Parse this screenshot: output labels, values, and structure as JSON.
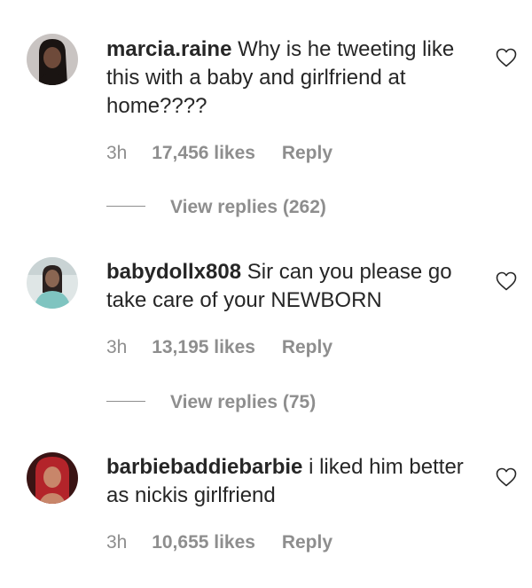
{
  "comments": [
    {
      "username": "marcia.raine",
      "text": "Why is he tweeting like this with a baby and girlfriend at home????",
      "time": "3h",
      "likes": "17,456 likes",
      "reply": "Reply",
      "view_replies": "View replies (262)",
      "avatar_colors": {
        "bg": "#c9c4c2",
        "skin": "#6e4a3a",
        "hair": "#1a1412"
      }
    },
    {
      "username": "babydollx808",
      "text": "Sir can you please go take care of your NEWBORN",
      "time": "3h",
      "likes": "13,195 likes",
      "reply": "Reply",
      "view_replies": "View replies (75)",
      "avatar_colors": {
        "bg": "#dfe6e6",
        "skin": "#8a6652",
        "hair": "#2b2220",
        "top": "#7fc4c0"
      }
    },
    {
      "username": "barbiebaddiebarbie",
      "text": "i liked him better as nickis girlfriend",
      "time": "3h",
      "likes": "10,655 likes",
      "reply": "Reply",
      "avatar_colors": {
        "bg": "#3a1414",
        "skin": "#c8866a",
        "hair": "#b3242a"
      }
    }
  ],
  "icons": {
    "like": "heart-outline-icon"
  }
}
